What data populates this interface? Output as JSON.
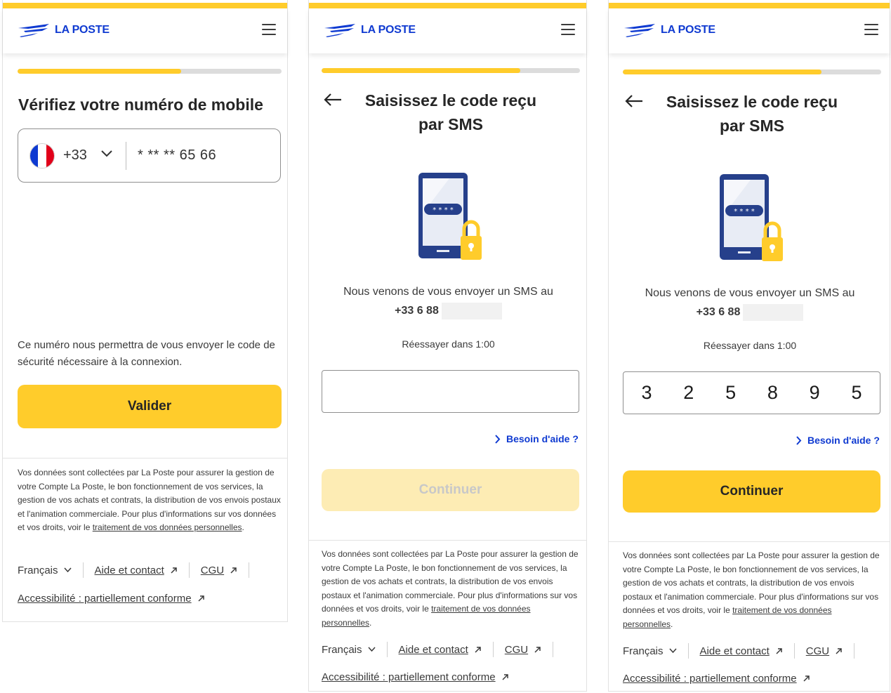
{
  "brand": {
    "name": "LA POSTE",
    "accent": "#ffcc2b",
    "blue": "#0f3ad1"
  },
  "screen1": {
    "progress": 0.62,
    "title": "Vérifiez votre numéro de mobile",
    "country_flag": "france-flag-icon",
    "country_code": "+33",
    "phone_value": "* ** ** 65 66",
    "info": "Ce numéro nous permettra de vous envoyer le code de sécurité nécessaire à la connexion.",
    "submit_label": "Valider"
  },
  "screen2": {
    "progress": 0.77,
    "title_line1": "Saisissez le code reçu",
    "title_line2": "par SMS",
    "sent_text": "Nous venons de vous envoyer un SMS au",
    "phone_partial": "+33 6 88",
    "retry": "Réessayer dans 1:00",
    "code_value": "",
    "help_label": "Besoin d'aide ?",
    "continue_label": "Continuer",
    "continue_enabled": false
  },
  "screen3": {
    "progress": 0.77,
    "title_line1": "Saisissez le code reçu",
    "title_line2": "par SMS",
    "sent_text": "Nous venons de vous envoyer un SMS au",
    "phone_partial": "+33 6 88",
    "retry": "Réessayer dans 1:00",
    "code_digits": [
      "3",
      "2",
      "5",
      "8",
      "9",
      "5"
    ],
    "help_label": "Besoin d'aide ?",
    "continue_label": "Continuer",
    "continue_enabled": true
  },
  "illustration": {
    "pin_mask": "* * * *",
    "icon": "sms-phone-lock-icon"
  },
  "footer": {
    "legal_text": "Vos données sont collectées par La Poste pour assurer la gestion de votre Compte La Poste, le bon fonctionnement de vos services, la gestion de vos achats et contrats, la distribution de vos envois postaux et l'animation commerciale. Pour plus d'informations sur vos données et vos droits, voir le ",
    "legal_link": "traitement de vos données personnelles",
    "legal_end": ".",
    "language": "Français",
    "help_contact": "Aide et contact",
    "cgu": "CGU",
    "accessibility": "Accessibilité : partiellement conforme"
  }
}
